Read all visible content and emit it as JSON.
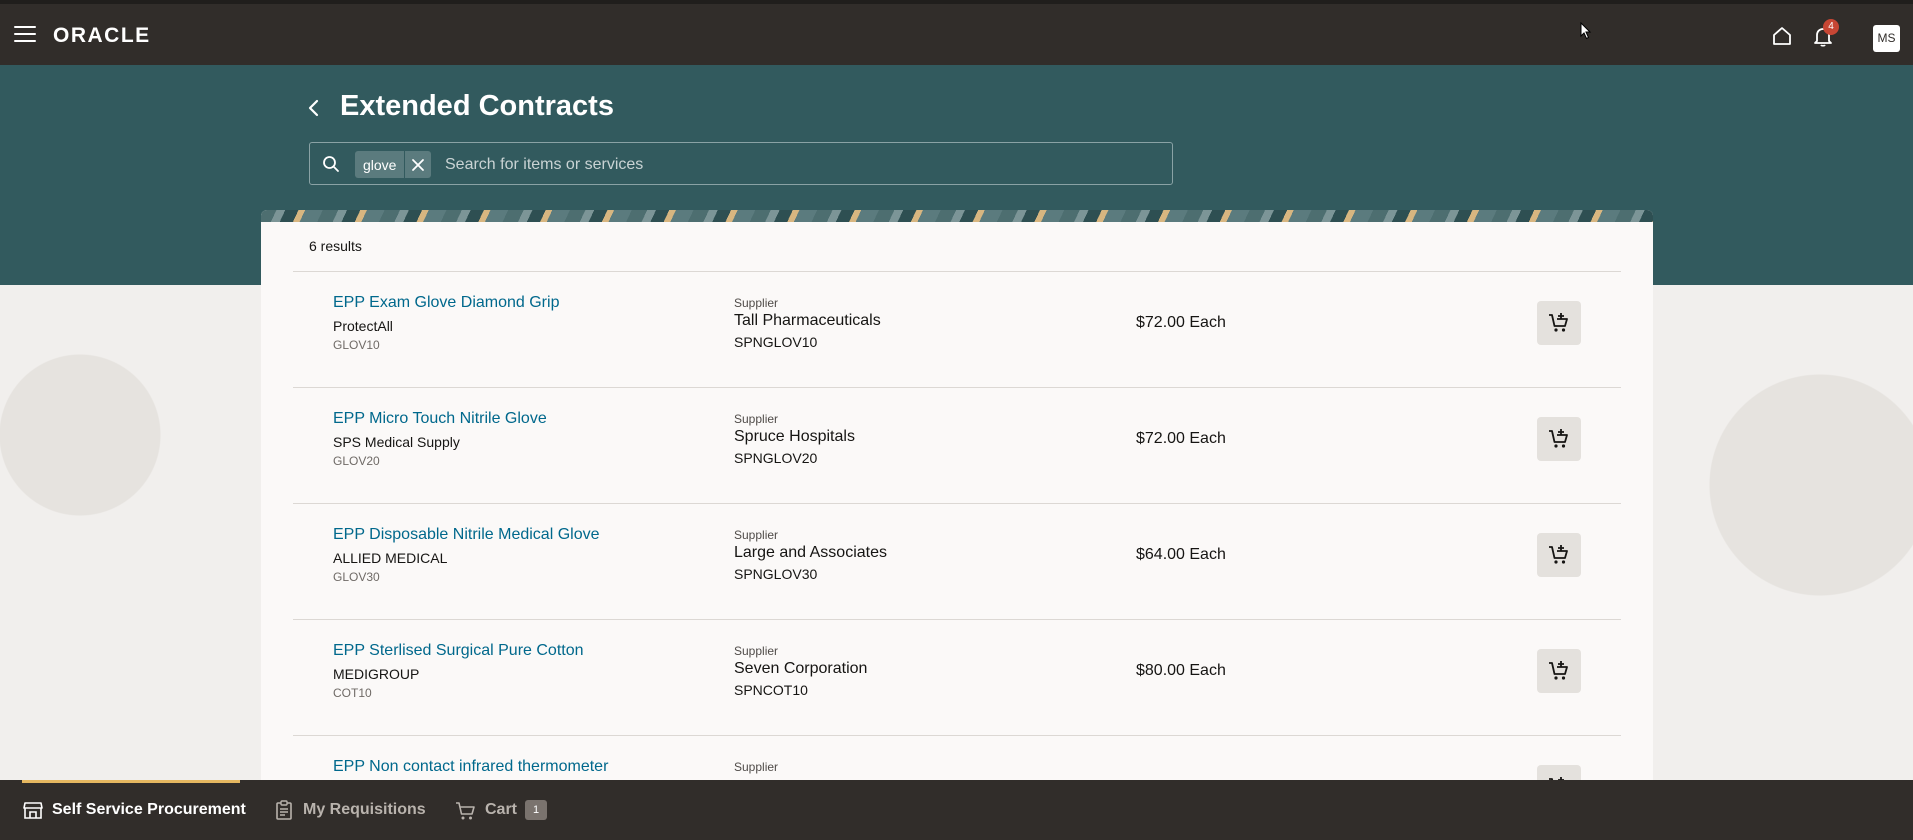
{
  "header": {
    "brand": "ORACLE",
    "notification_count": "4",
    "user_initials": "MS"
  },
  "page": {
    "title": "Extended Contracts"
  },
  "search": {
    "chip": "glove",
    "placeholder": "Search for items or services"
  },
  "results": {
    "count_label": "6 results",
    "supplier_label": "Supplier",
    "items": [
      {
        "name": "EPP Exam Glove Diamond Grip",
        "brand": "ProtectAll",
        "code": "GLOV10",
        "supplier": "Tall Pharmaceuticals",
        "supplier_code": "SPNGLOV10",
        "price": "$72.00 Each"
      },
      {
        "name": "EPP Micro Touch Nitrile Glove",
        "brand": "SPS Medical Supply",
        "code": "GLOV20",
        "supplier": "Spruce Hospitals",
        "supplier_code": "SPNGLOV20",
        "price": "$72.00 Each"
      },
      {
        "name": "EPP Disposable Nitrile Medical Glove",
        "brand": "ALLIED MEDICAL",
        "code": "GLOV30",
        "supplier": "Large and Associates",
        "supplier_code": "SPNGLOV30",
        "price": "$64.00 Each"
      },
      {
        "name": "EPP Sterlised Surgical Pure Cotton",
        "brand": "MEDIGROUP",
        "code": "COT10",
        "supplier": "Seven Corporation",
        "supplier_code": "SPNCOT10",
        "price": "$80.00 Each"
      },
      {
        "name": "EPP Non contact infrared thermometer",
        "brand": "",
        "code": "",
        "supplier": "",
        "supplier_code": "",
        "price": ""
      }
    ]
  },
  "bottom_nav": {
    "items": [
      {
        "label": "Self Service Procurement"
      },
      {
        "label": "My Requisitions"
      },
      {
        "label": "Cart",
        "count": "1"
      }
    ]
  },
  "colors": {
    "topbar": "#312d2a",
    "band": "#325a5e",
    "link": "#00688c",
    "badge": "#c74634",
    "active_tab": "#e5b760"
  }
}
